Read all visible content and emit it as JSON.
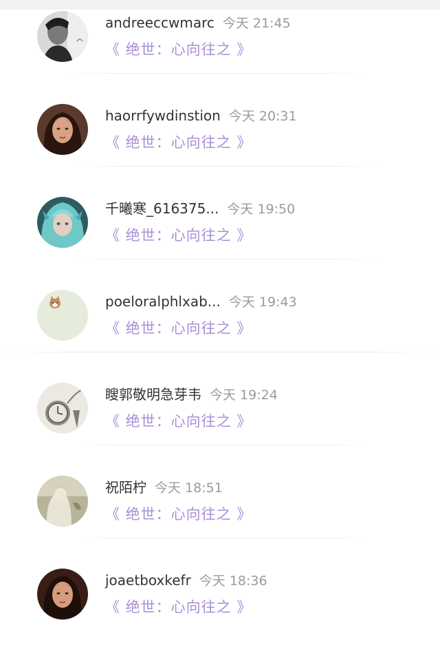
{
  "comments": [
    {
      "username": "andreeccwmarc",
      "time": "今天 21:45",
      "book": "《 绝世：心向往之 》",
      "avatar": "man-bw-portrait"
    },
    {
      "username": "haorrfywdinstion",
      "time": "今天 20:31",
      "book": "《 绝世：心向往之 》",
      "avatar": "woman-portrait"
    },
    {
      "username": "千曦寒_616375...",
      "time": "今天 19:50",
      "book": "《 绝世：心向往之 》",
      "avatar": "teal-hair-character"
    },
    {
      "username": "poeloralphlxab...",
      "time": "今天 19:43",
      "book": "《 绝世：心向往之 》",
      "avatar": "cat-on-pale-green"
    },
    {
      "username": "瞍郭敬明急芽韦",
      "time": "今天 19:24",
      "book": "《 绝世：心向往之 》",
      "avatar": "pocket-watch"
    },
    {
      "username": "祝陌柠",
      "time": "今天 18:51",
      "book": "《 绝世：心向往之 》",
      "avatar": "vintage-illustration"
    },
    {
      "username": "joaetboxkefr",
      "time": "今天 18:36",
      "book": "《 绝世：心向往之 》",
      "avatar": "woman-portrait"
    }
  ],
  "colors": {
    "username": "#333333",
    "time": "#9a9a9a",
    "book_link": "#a98fd6",
    "divider": "#ececec"
  }
}
